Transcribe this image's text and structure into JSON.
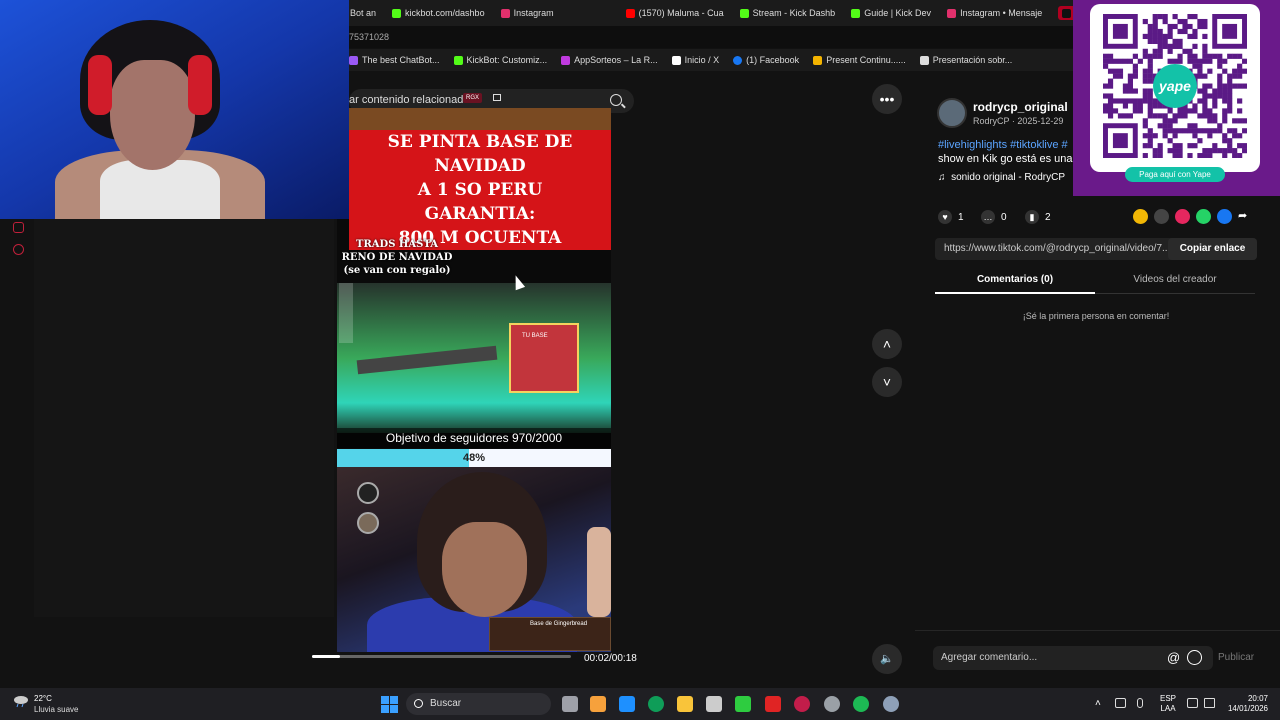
{
  "browser": {
    "tabs": [
      {
        "label": "Bot an",
        "color": "#888888"
      },
      {
        "label": "kickbot.com/dashbo",
        "color": "#53fc18"
      },
      {
        "label": "Instagram",
        "color": "#e1306c"
      },
      {
        "label": "(1570) Maluma - Cua",
        "color": "#ff0000"
      },
      {
        "label": "Stream - Kick Dashb",
        "color": "#53fc18"
      },
      {
        "label": "Guide | Kick Dev",
        "color": "#53fc18"
      },
      {
        "label": "Instagram • Mensaje",
        "color": "#e1306c"
      },
      {
        "label": "R",
        "color": "#ffffff"
      }
    ],
    "url_fragment": "75371028",
    "bookmarks": [
      {
        "label": "The best ChatBot...",
        "color": "#9b59f5"
      },
      {
        "label": "KickBot: Customiz...",
        "color": "#53fc18"
      },
      {
        "label": "AppSorteos – La R...",
        "color": "#c03adf"
      },
      {
        "label": "Inicio / X",
        "color": "#ffffff"
      },
      {
        "label": "(1) Facebook",
        "color": "#1877f2"
      },
      {
        "label": "Present Continu......",
        "color": "#f4b400"
      },
      {
        "label": "Presentación sobr...",
        "color": "#dddddd"
      }
    ]
  },
  "search": {
    "text": "ar contenido relacionado",
    "badge": "RGX"
  },
  "video": {
    "banner_lines": [
      "SE PINTA BASE DE NAVIDAD",
      "A 1 SO PERU",
      "GARANTIA:",
      "800 M OCUENTA"
    ],
    "trads_lines": [
      "TRADS HASTA",
      "RENO DE NAVIDAD",
      "(se van con regalo)"
    ],
    "game_sign": "TU BASE",
    "goal_text": "Objetivo de seguidores 970/2000",
    "progress_percent": 48,
    "progress_label": "48%",
    "gingerbread_label": "Base de Gingerbread",
    "time": "00:02/00:18",
    "played_fraction": 0.11
  },
  "author": {
    "username": "rodrycp_original",
    "subtitle": "RodryCP · 2025-12-29",
    "hashtags": "#livehighlights #tiktoklive #",
    "description": "show en Kik go está es una",
    "sound": "sonido original - RodryCP"
  },
  "stats": {
    "likes": "1",
    "comments": "0",
    "saves": "2"
  },
  "share": {
    "link": "https://www.tiktok.com/@rodrycp_original/video/7...",
    "copy_label": "Copiar enlace",
    "colors": [
      "#f2b705",
      "#444444",
      "#e6275f",
      "#25d366",
      "#1877f2"
    ]
  },
  "tabs": {
    "comments": "Comentarios (0)",
    "creator_videos": "Videos del creador"
  },
  "comments": {
    "empty_text": "¡Sé la primera persona en comentar!",
    "placeholder": "Agregar comentario...",
    "publish": "Publicar"
  },
  "qr": {
    "badge": "Paga aquí con Yape",
    "logo_text": "yape"
  },
  "taskbar": {
    "temperature": "22°C",
    "weather": "Lluvia suave",
    "search": "Buscar",
    "lang_line1": "ESP",
    "lang_line2": "LAA",
    "time": "20:07",
    "date": "14/01/2026",
    "app_colors": [
      "#9ea0a8",
      "#f6a13c",
      "#1e90ff",
      "#0f9d58",
      "#f9c43a",
      "#cccccc",
      "#2ecc40",
      "#e02424",
      "#c21d4a",
      "#9aa0a6",
      "#1db954",
      "#8ea0b8"
    ]
  },
  "colors": {
    "accent": "#fe2c55",
    "link": "#5ba4ff",
    "banner_red": "#d51418",
    "yape_teal": "#13c2a8"
  }
}
